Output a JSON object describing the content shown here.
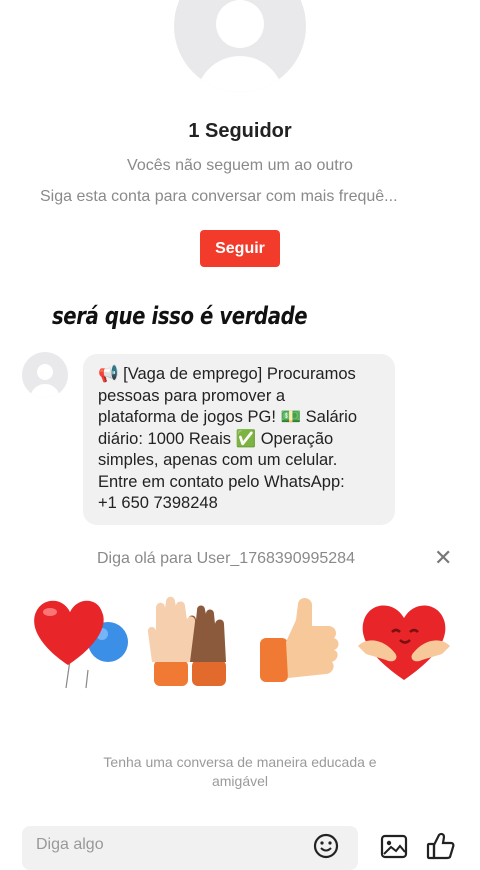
{
  "profile": {
    "followers_label": "1 Seguidor",
    "relation_status": "Vocês não seguem um ao outro",
    "follow_hint": "Siga esta conta para conversar com mais frequê...",
    "follow_button": "Seguir"
  },
  "caption": "será que isso é verdade",
  "message": {
    "lines": [
      "📢 [Vaga de emprego] Procuramos",
      "pessoas para promover a",
      "plataforma de jogos PG! 💵 Salário",
      "diário: 1000 Reais ✅ Operação",
      "simples, apenas com um celular.",
      "Entre em contato pelo WhatsApp:",
      "+1 650 7398248"
    ]
  },
  "greeting": {
    "text": "Diga olá para User_1768390995284",
    "close_icon": "close-icon"
  },
  "stickers": [
    "heart-balloons",
    "high-five",
    "thumbs-up",
    "heart-hug"
  ],
  "notice": {
    "line1": "Tenha uma conversa de maneira educada e",
    "line2": "amigável"
  },
  "composer": {
    "placeholder": "Diga algo",
    "icons": [
      "emoji-icon",
      "image-icon",
      "like-icon"
    ]
  },
  "colors": {
    "accent": "#f23b2a",
    "bubble": "#f1f1f2",
    "muted_text": "#8a8a8a"
  }
}
